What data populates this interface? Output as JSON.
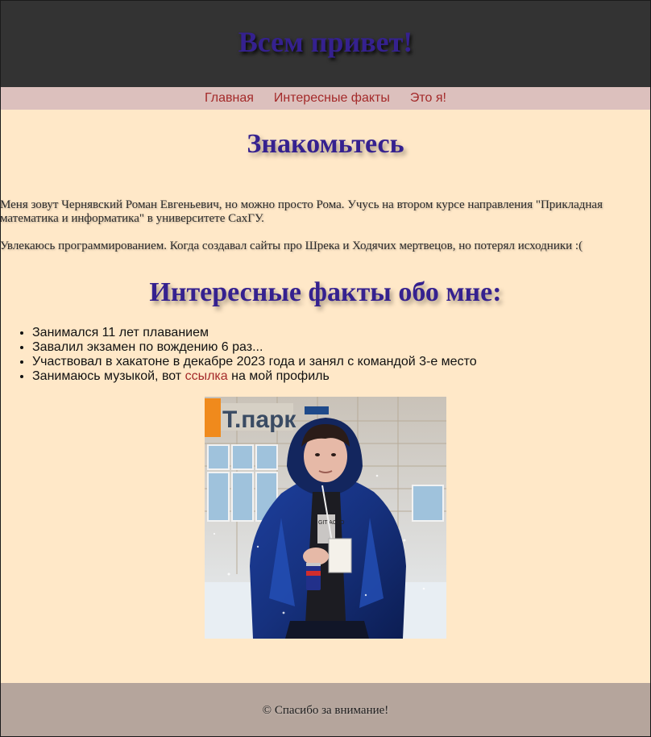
{
  "header": {
    "title": "Всем привет!"
  },
  "nav": {
    "items": [
      {
        "label": "Главная"
      },
      {
        "label": "Интересные факты"
      },
      {
        "label": "Это я!"
      }
    ]
  },
  "intro": {
    "title": "Знакомьтесь",
    "paragraph1": "Меня зовут Чернявский Роман Евгеньевич, но можно просто Рома. Учусь на втором курсе направления \"Прикладная математика и информатика\" в университете СахГУ.",
    "paragraph2": "Увлекаюсь программированием. Когда создавал сайты про Шрека и Ходячих мертвецов, но потерял исходники :("
  },
  "facts": {
    "title": "Интересные факты обо мне:",
    "items": [
      "Занимался 11 лет плаванием",
      "Завалил экзамен по вождению 6 раз...",
      "Участвовал в хакатоне в декабре 2023 года и занял с командой 3-е место"
    ],
    "music": {
      "before": "Занимаюсь музыкой, вот ",
      "link": "ссылка",
      "after": " на мой профиль"
    }
  },
  "photo": {
    "sign_text": "Т.парк",
    "badge_text": "GIT ACTO"
  },
  "footer": {
    "text": "© Спасибо за внимание!"
  },
  "colors": {
    "header_bg": "#333333",
    "title_color": "#35218f",
    "nav_bg": "#dcc0bd",
    "link_color": "#a42a2a",
    "page_bg": "#ffe8c8"
  }
}
